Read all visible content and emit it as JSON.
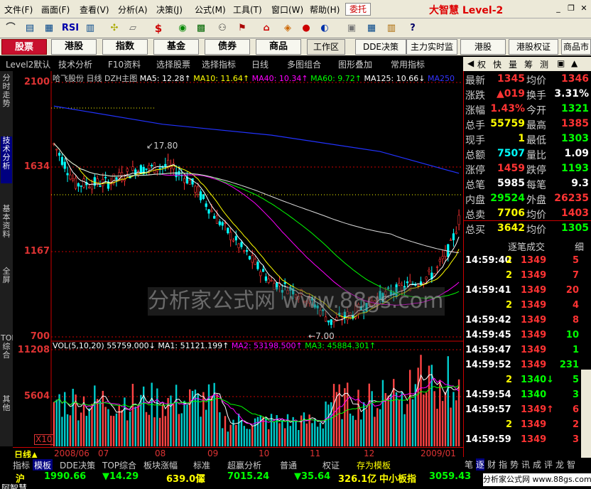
{
  "menu": {
    "items": [
      "文件(F)",
      "画面(F)",
      "查看(V)",
      "分析(A)",
      "决策(J)",
      "公式(M)",
      "工具(T)",
      "窗口(W)",
      "帮助(H)"
    ],
    "quit": "委托",
    "brand": "大智慧 Level-2"
  },
  "toolbar": {
    "rsi": "RSI",
    "dollar": "$"
  },
  "nav": {
    "stocks": "股票",
    "hk": "港股",
    "index": "指数",
    "fund": "基金",
    "bond": "债券",
    "commodity": "商品",
    "workspace": "工作区",
    "dde": "DDE决策",
    "mainforce": "主力实时监控",
    "hk2": "港股",
    "hk_warrant": "港股权证",
    "commodity2": "商品市"
  },
  "funcbar": {
    "level2": "Level2默认",
    "tech": "技术分析",
    "f10": "F10资料",
    "select_stock": "选择股票",
    "select_indicator": "选择指标",
    "period": "日线",
    "multi": "多图组合",
    "overlay": "图形叠加",
    "common": "常用指标"
  },
  "ctl": {
    "right": "权",
    "kuai": "快",
    "vol": "量",
    "cs": "筹",
    "tw": "测"
  },
  "sidetabs": [
    "分时走势",
    "技术分析",
    "基本资料",
    "全屏",
    "TOP综合",
    "其他"
  ],
  "chart": {
    "stock_name": "哈飞股份",
    "period": "日线",
    "type_label": "DZH主图",
    "ma_legend": [
      {
        "label": "MA5: 12.28↑",
        "color": "#ffffff"
      },
      {
        "label": "MA10: 11.64↑",
        "color": "#ffff00"
      },
      {
        "label": "MA40: 10.34↑",
        "color": "#ff00ff"
      },
      {
        "label": "MA60: 9.72↑",
        "color": "#00ff00"
      },
      {
        "label": "MA125: 10.66↓",
        "color": "#ffffff"
      },
      {
        "label": "MA250",
        "color": "#0000ff"
      }
    ],
    "price_axis": [
      "2100",
      "1634",
      "1167",
      "700"
    ],
    "high_marker": "17.80",
    "low_marker": "7.00",
    "vol_legend": [
      {
        "label": "VOL(5,10,20)",
        "color": "#ffffff"
      },
      {
        "label": "55759.000↓",
        "color": "#ffffff"
      },
      {
        "label": "MA1: 51121.199↑",
        "color": "#ffffff"
      },
      {
        "label": "MA2: 53198.500↑",
        "color": "#ff00ff"
      },
      {
        "label": "MA3: 45884.301↑",
        "color": "#00ff00"
      }
    ],
    "vol_axis": [
      "11208",
      "5604"
    ],
    "vol_unit": "X10",
    "dates": [
      "2008/06",
      "07",
      "08",
      "09",
      "10",
      "11",
      "12",
      "2009/01"
    ],
    "period_label": "日线",
    "watermark": "分析家公式网 www.88gs.com"
  },
  "chart_data": {
    "type": "candlestick",
    "ylim": [
      700,
      2100
    ],
    "x_labels": [
      "2008/06",
      "07",
      "08",
      "09",
      "10",
      "11",
      "12",
      "2009/01"
    ],
    "marked_high": 17.8,
    "marked_low": 7.0,
    "ma": {
      "MA5": 12.28,
      "MA10": 11.64,
      "MA40": 10.34,
      "MA60": 9.72,
      "MA125": 10.66
    },
    "volume": {
      "latest": 55759.0,
      "MA1": 51121.199,
      "MA2": 53198.5,
      "MA3": 45884.301,
      "ylim": [
        0,
        11208
      ]
    }
  },
  "tabs": [
    "指标",
    "模板",
    "DDE决策",
    "TOP综合",
    "板块涨幅",
    "标准",
    "超赢分析",
    "普通",
    "权证",
    "存为模板"
  ],
  "quotes": [
    {
      "l1": "最新",
      "v1": "1345",
      "c1": "#ff3333",
      "l2": "均价",
      "v2": "1346",
      "c2": "#ff3333"
    },
    {
      "l1": "涨跌",
      "v1": "▲019",
      "c1": "#ff3333",
      "l2": "换手",
      "v2": "3.31%",
      "c2": "#ffffff"
    },
    {
      "l1": "涨幅",
      "v1": "1.43%",
      "c1": "#ff3333",
      "l2": "今开",
      "v2": "1321",
      "c2": "#00ff00"
    },
    {
      "l1": "总手",
      "v1": "55759",
      "c1": "#ffff00",
      "l2": "最高",
      "v2": "1385",
      "c2": "#ff3333"
    },
    {
      "l1": "现手",
      "v1": "1",
      "c1": "#ffff00",
      "l2": "最低",
      "v2": "1303",
      "c2": "#00ff00"
    },
    {
      "l1": "总额",
      "v1": "7507",
      "c1": "#00ffff",
      "l2": "量比",
      "v2": "1.09",
      "c2": "#ffffff"
    },
    {
      "l1": "涨停",
      "v1": "1459",
      "c1": "#ff3333",
      "l2": "跌停",
      "v2": "1193",
      "c2": "#00ff00"
    },
    {
      "l1": "总笔",
      "v1": "5985",
      "c1": "#ffffff",
      "l2": "每笔",
      "v2": "9.3",
      "c2": "#ffffff"
    },
    {
      "l1": "内盘",
      "v1": "29524",
      "c1": "#00ff00",
      "l2": "外盘",
      "v2": "26235",
      "c2": "#ff3333"
    },
    {
      "l1": "总卖",
      "v1": "7706",
      "c1": "#ffff00",
      "l2": "均价",
      "v2": "1403",
      "c2": "#ff3333"
    },
    {
      "l1": "总买",
      "v1": "3642",
      "c1": "#ffff00",
      "l2": "均价",
      "v2": "1305",
      "c2": "#00ff00"
    }
  ],
  "trades": {
    "header": "逐笔成交",
    "detail": "细",
    "rows": [
      {
        "time": "14:59:40",
        "vol": "2",
        "price": "1349",
        "pc": "#ff3333",
        "n": "5",
        "nc": "#ff3333"
      },
      {
        "time": "",
        "vol": "2",
        "price": "1349",
        "pc": "#ff3333",
        "n": "7",
        "nc": "#ff3333"
      },
      {
        "time": "14:59:41",
        "vol": "",
        "price": "1349",
        "pc": "#ff3333",
        "n": "20",
        "nc": "#ff3333"
      },
      {
        "time": "",
        "vol": "2",
        "price": "1349",
        "pc": "#ff3333",
        "n": "4",
        "nc": "#ff3333"
      },
      {
        "time": "14:59:42",
        "vol": "",
        "price": "1349",
        "pc": "#ff3333",
        "n": "8",
        "nc": "#ff3333"
      },
      {
        "time": "14:59:45",
        "vol": "",
        "price": "1349",
        "pc": "#ff3333",
        "n": "10",
        "nc": "#00ff00"
      },
      {
        "time": "14:59:47",
        "vol": "",
        "price": "1349",
        "pc": "#ff3333",
        "n": "1",
        "nc": "#00ff00"
      },
      {
        "time": "14:59:52",
        "vol": "",
        "price": "1349",
        "pc": "#ff3333",
        "n": "231",
        "nc": "#00ff00"
      },
      {
        "time": "",
        "vol": "2",
        "price": "1340↓",
        "pc": "#00ff00",
        "n": "5",
        "nc": "#00ff00"
      },
      {
        "time": "14:59:54",
        "vol": "",
        "price": "1340",
        "pc": "#00ff00",
        "n": "3",
        "nc": "#00ff00"
      },
      {
        "time": "14:59:57",
        "vol": "",
        "price": "1349↑",
        "pc": "#ff3333",
        "n": "6",
        "nc": "#ff3333"
      },
      {
        "time": "",
        "vol": "2",
        "price": "1349",
        "pc": "#ff3333",
        "n": "2",
        "nc": "#ff3333"
      },
      {
        "time": "14:59:59",
        "vol": "",
        "price": "1349",
        "pc": "#ff3333",
        "n": "3",
        "nc": "#ff3333"
      }
    ]
  },
  "rtabs": [
    "笔",
    "逐",
    "财",
    "指",
    "势",
    "讯",
    "成",
    "评",
    "龙",
    "智"
  ],
  "status": {
    "sh_label": "沪",
    "sh_val": "1990.66",
    "sh_chg": "▼14.29",
    "sh_amt": "639.0亿",
    "sz_label": "深",
    "sz_val": "7015.24",
    "sz_chg": "▼35.64",
    "sz_amt": "326.1亿",
    "zxb_label": "中小板指",
    "zxb_val": "3059.43",
    "site": "分析家公式网 www.88gs.com",
    "bottom_text": "阿智慧"
  }
}
